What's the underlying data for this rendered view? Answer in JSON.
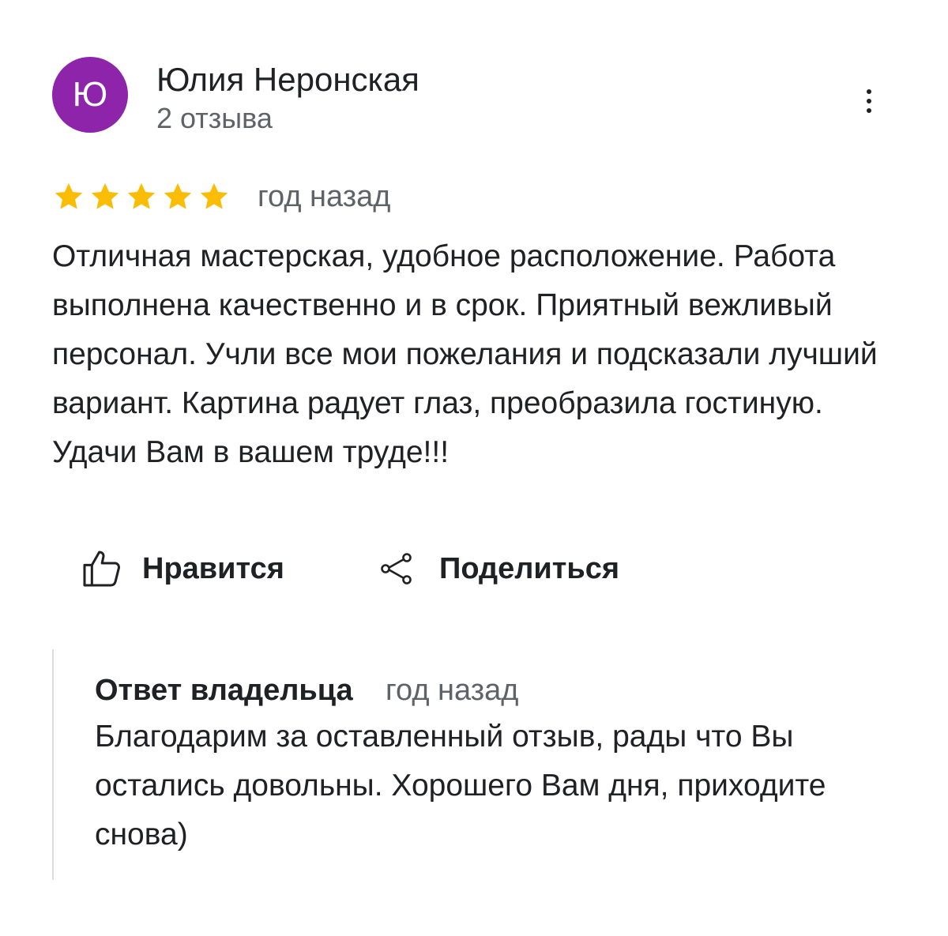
{
  "colors": {
    "avatar_bg": "#8e24aa",
    "star": "#fbbc04",
    "secondary_text": "#5f6368",
    "primary_text": "#202124",
    "divider": "#dadce0"
  },
  "review": {
    "author": {
      "initial": "Ю",
      "name": "Юлия Неронская",
      "reviews_count": "2 отзыва"
    },
    "menu_icon": "more-vert-icon",
    "rating": 5,
    "rating_max": 5,
    "date": "год назад",
    "text": "Отличная мастерская, удобное расположение. Работа выполнена качественно и в срок. Приятный вежливый персонал. Учли все мои пожелания и подсказали лучший вариант. Картина радует глаз, преобразила гостиную. Удачи Вам в вашем труде!!!",
    "actions": {
      "like_label": "Нравится",
      "like_icon": "thumbs-up-icon",
      "share_label": "Поделиться",
      "share_icon": "share-icon"
    },
    "owner_reply": {
      "title": "Ответ владельца",
      "date": "год назад",
      "text": "Благодарим за оставленный отзыв, рады что Вы остались довольны. Хорошего Вам дня, приходите снова)"
    }
  }
}
